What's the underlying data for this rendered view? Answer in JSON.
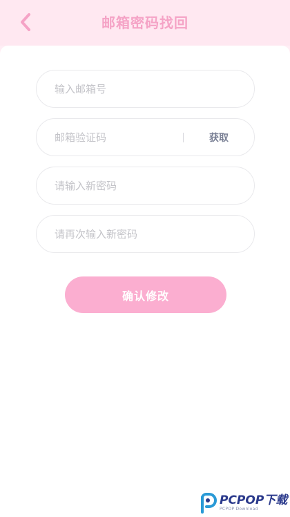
{
  "header": {
    "title": "邮箱密码找回",
    "back_icon": "chevron-left-icon"
  },
  "form": {
    "email": {
      "placeholder": "输入邮箱号",
      "value": ""
    },
    "code": {
      "placeholder": "邮箱验证码",
      "value": "",
      "get_label": "获取"
    },
    "new_password": {
      "placeholder": "请输入新密码",
      "value": ""
    },
    "confirm_password": {
      "placeholder": "请再次输入新密码",
      "value": ""
    },
    "submit_label": "确认修改"
  },
  "watermark": {
    "main": "PCPOP下载",
    "sub": "PCPOP Download"
  },
  "colors": {
    "accent": "#fbaed0",
    "title": "#f5a3c6",
    "header_bg": "#ffe8f1"
  }
}
